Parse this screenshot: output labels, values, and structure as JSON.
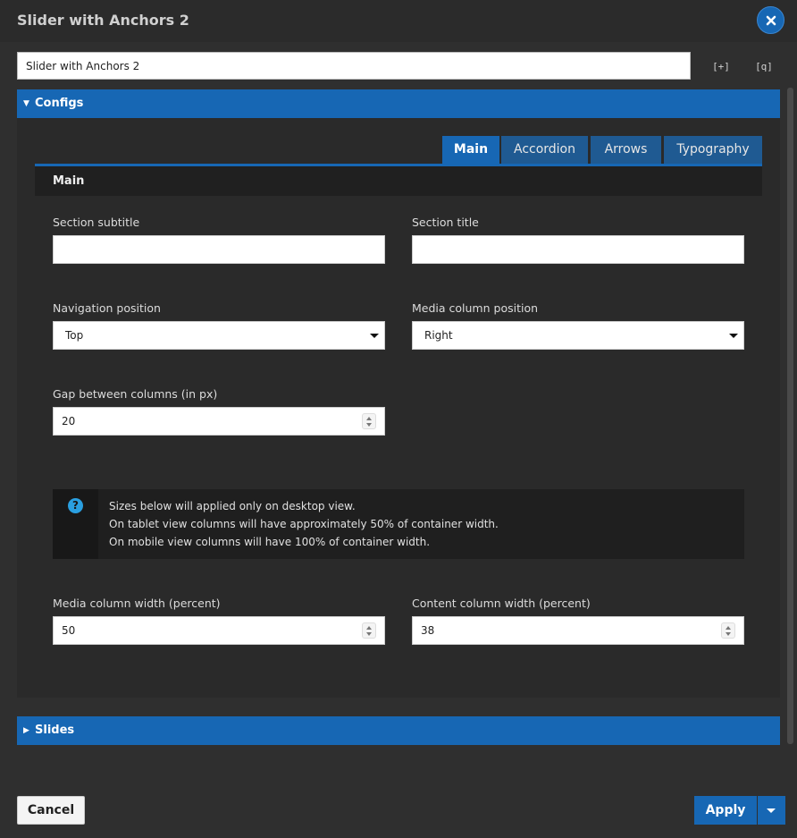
{
  "window": {
    "title": "Slider with Anchors 2",
    "close_icon": "close-icon",
    "accent": "#1767b4"
  },
  "toolbar": {
    "name_value": "Slider with Anchors 2",
    "expand_icon_glyph": "[+]",
    "search_icon_glyph": "[q]"
  },
  "configs": {
    "label": "Configs",
    "tabs": [
      {
        "label": "Main"
      },
      {
        "label": "Accordion"
      },
      {
        "label": "Arrows"
      },
      {
        "label": "Typography"
      }
    ],
    "main_heading": "Main",
    "fields": {
      "section_subtitle": {
        "label": "Section subtitle",
        "value": ""
      },
      "section_title": {
        "label": "Section title",
        "value": ""
      },
      "navigation_position": {
        "label": "Navigation position",
        "value": "Top"
      },
      "media_column_position": {
        "label": "Media column position",
        "value": "Right"
      },
      "gap_between_columns": {
        "label": "Gap between columns (in px)",
        "value": "20"
      },
      "media_column_width": {
        "label": "Media column width (percent)",
        "value": "50"
      },
      "content_column_width": {
        "label": "Content column width (percent)",
        "value": "38"
      }
    },
    "info": {
      "icon": "question-circle-icon",
      "lines": [
        "Sizes below will applied only on desktop view.",
        "On tablet view columns will have approximately 50% of container width.",
        "On mobile view columns will have 100% of container width."
      ]
    }
  },
  "slides": {
    "label": "Slides"
  },
  "footer": {
    "cancel_label": "Cancel",
    "apply_label": "Apply"
  }
}
